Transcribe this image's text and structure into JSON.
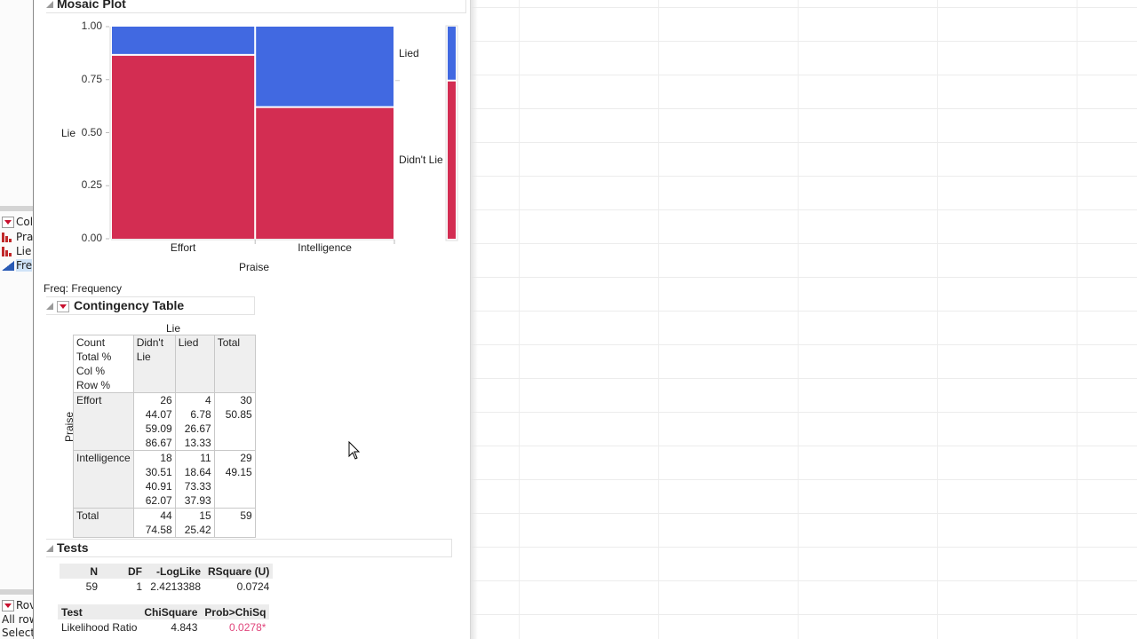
{
  "left_panel": {
    "columns_header": "Col",
    "columns": [
      {
        "label": "Pra",
        "icon": "nominal-bar-icon",
        "selected": false
      },
      {
        "label": "Lie",
        "icon": "nominal-bar-icon",
        "selected": false
      },
      {
        "label": "Fre",
        "icon": "continuous-triangle-icon",
        "selected": true
      }
    ],
    "rows_header": "Rov",
    "rows_items": [
      "All row",
      "Selecte"
    ]
  },
  "mosaic": {
    "title": "Mosaic Plot",
    "y_axis_label": "Lie",
    "x_axis_label": "Praise",
    "legend": [
      "Lied",
      "Didn't Lie"
    ],
    "freq_note": "Freq: Frequency",
    "colors": {
      "lied": "#4169e1",
      "didnt_lie": "#d32d52"
    }
  },
  "chart_data": {
    "type": "mosaic",
    "title": "Mosaic Plot",
    "xlabel": "Praise",
    "ylabel": "Lie",
    "categories": [
      "Effort",
      "Intelligence"
    ],
    "category_share": [
      0.5085,
      0.4915
    ],
    "series": [
      {
        "name": "Didn't Lie",
        "values": [
          0.8667,
          0.6207
        ]
      },
      {
        "name": "Lied",
        "values": [
          0.1333,
          0.3793
        ]
      }
    ],
    "marginal": {
      "Didn't Lie": 0.7458,
      "Lied": 0.2542
    },
    "y_ticks": [
      "0.00",
      "0.25",
      "0.50",
      "0.75",
      "1.00"
    ],
    "ylim": [
      0,
      1
    ],
    "legend_position": "right"
  },
  "contingency": {
    "title": "Contingency Table",
    "col_var": "Lie",
    "row_var": "Praise",
    "stat_labels": [
      "Count",
      "Total %",
      "Col %",
      "Row %"
    ],
    "col_headers": [
      "Didn't\nLie",
      "Lied",
      "Total"
    ],
    "rows": [
      {
        "label": "Effort",
        "didnt_lie": [
          "26",
          "44.07",
          "59.09",
          "86.67"
        ],
        "lied": [
          "4",
          "6.78",
          "26.67",
          "13.33"
        ],
        "total": [
          "30",
          "50.85"
        ]
      },
      {
        "label": "Intelligence",
        "didnt_lie": [
          "18",
          "30.51",
          "40.91",
          "62.07"
        ],
        "lied": [
          "11",
          "18.64",
          "73.33",
          "37.93"
        ],
        "total": [
          "29",
          "49.15"
        ]
      },
      {
        "label": "Total",
        "didnt_lie": [
          "44",
          "74.58"
        ],
        "lied": [
          "15",
          "25.42"
        ],
        "total": [
          "59"
        ]
      }
    ]
  },
  "tests": {
    "title": "Tests",
    "summary_headers": [
      "N",
      "DF",
      "-LogLike",
      "RSquare (U)"
    ],
    "summary_values": [
      "59",
      "1",
      "2.4213388",
      "0.0724"
    ],
    "test_headers": [
      "Test",
      "ChiSquare",
      "Prob>ChiSq"
    ],
    "test_rows": [
      {
        "test": "Likelihood Ratio",
        "chisq": "4.843",
        "prob": "0.0278*"
      }
    ]
  }
}
